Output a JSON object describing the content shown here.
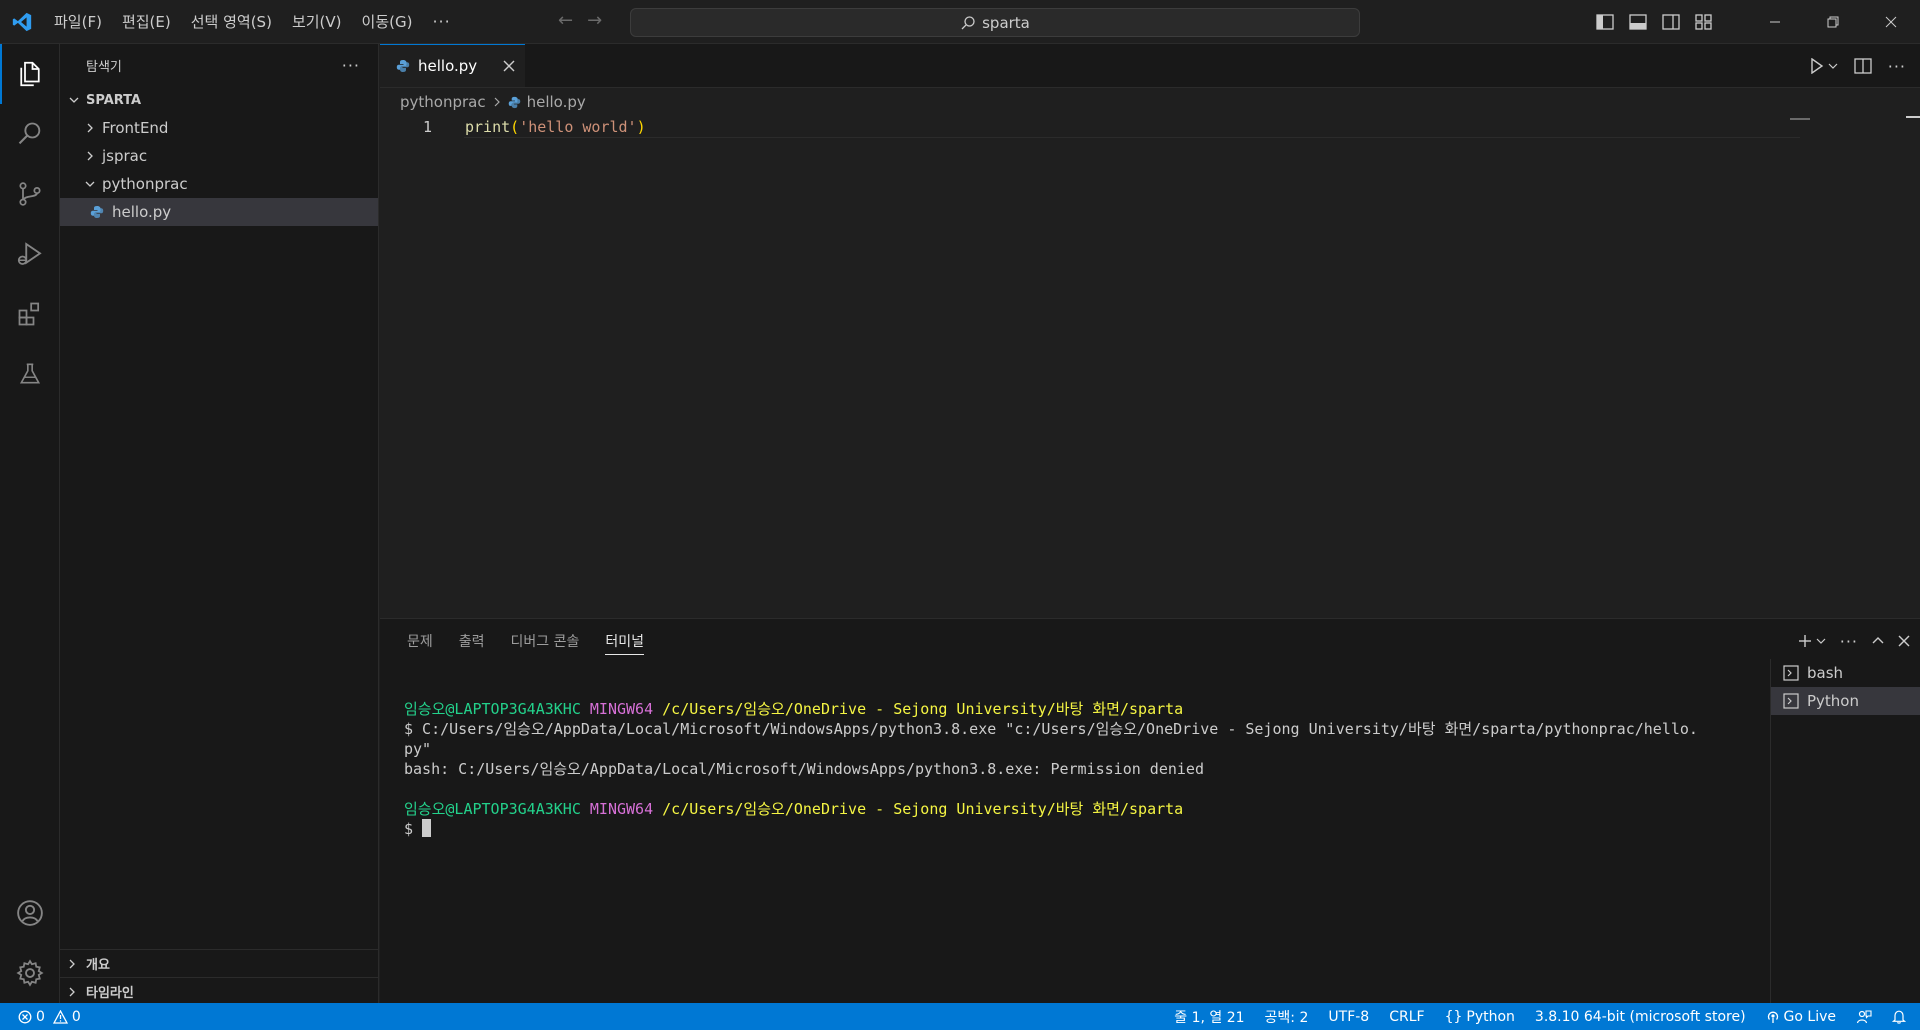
{
  "menu": {
    "items": [
      "파일(F)",
      "편집(E)",
      "선택 영역(S)",
      "보기(V)",
      "이동(G)"
    ],
    "more": "···"
  },
  "search": {
    "text": "sparta"
  },
  "sidebar": {
    "title": "탐색기",
    "more": "···",
    "root": "SPARTA",
    "folders": [
      "FrontEnd",
      "jsprac",
      "pythonprac"
    ],
    "file": "hello.py",
    "sections": [
      "개요",
      "타임라인"
    ]
  },
  "editor": {
    "tab_label": "hello.py",
    "breadcrumb_folder": "pythonprac",
    "breadcrumb_file": "hello.py",
    "line_number": "1",
    "code_fn": "print",
    "code_open": "(",
    "code_str": "'hello world'",
    "code_close": ")"
  },
  "panel": {
    "tabs": [
      "문제",
      "출력",
      "디버그 콘솔",
      "터미널"
    ],
    "active_tab": "터미널",
    "terminal": {
      "prompt_user": "임승오@LAPTOP3G4A3KHC",
      "prompt_env": "MINGW64",
      "prompt_path": "/c/Users/임승오/OneDrive - Sejong University/바탕 화면/sparta",
      "cmd_line1": "$ C:/Users/임승오/AppData/Local/Microsoft/WindowsApps/python3.8.exe \"c:/Users/임승오/OneDrive - Sejong University/바탕 화면/sparta/pythonprac/hello.",
      "cmd_line2": "py\"",
      "error_line": "bash: C:/Users/임승오/AppData/Local/Microsoft/WindowsApps/python3.8.exe: Permission denied",
      "dollar": "$"
    },
    "terminals": [
      "bash",
      "Python"
    ]
  },
  "status": {
    "errors": "0",
    "warnings": "0",
    "position": "줄 1, 열 21",
    "spaces": "공백: 2",
    "encoding": "UTF-8",
    "eol": "CRLF",
    "language": "Python",
    "interpreter": "3.8.10 64-bit (microsoft store)",
    "golive": "Go Live"
  },
  "colors": {
    "accent": "#0078d4",
    "statusbar": "#0078d4",
    "prompt_green": "#23d18b",
    "prompt_magenta": "#d670d6",
    "prompt_yellow": "#f5f543"
  }
}
